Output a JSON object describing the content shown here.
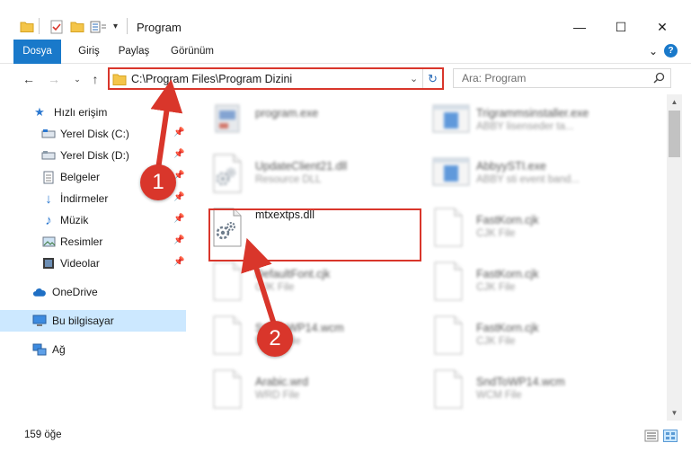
{
  "window": {
    "title": "Program",
    "minimize_glyph": "—",
    "maximize_glyph": "☐",
    "close_glyph": "✕"
  },
  "ribbon": {
    "tabs": [
      "Dosya",
      "Giriş",
      "Paylaş",
      "Görünüm"
    ],
    "expand_glyph": "⌄",
    "help_glyph": "?"
  },
  "address": {
    "path": "C:\\Program Files\\Program Dizini",
    "search_placeholder": "Ara: Program"
  },
  "sidebar": {
    "items": [
      {
        "label": "Hızlı erişim",
        "icon": "star-icon"
      },
      {
        "label": "Yerel Disk (C:)",
        "icon": "drive-icon",
        "pinned": true
      },
      {
        "label": "Yerel Disk (D:)",
        "icon": "drive-icon",
        "pinned": true
      },
      {
        "label": "Belgeler",
        "icon": "document-icon",
        "pinned": true
      },
      {
        "label": "İndirmeler",
        "icon": "download-icon",
        "pinned": true
      },
      {
        "label": "Müzik",
        "icon": "music-icon",
        "pinned": true
      },
      {
        "label": "Resimler",
        "icon": "pictures-icon",
        "pinned": true
      },
      {
        "label": "Videolar",
        "icon": "video-icon",
        "pinned": true
      },
      {
        "label": "OneDrive",
        "icon": "cloud-icon"
      },
      {
        "label": "Bu bilgisayar",
        "icon": "computer-icon",
        "selected": true
      },
      {
        "label": "Ağ",
        "icon": "network-icon"
      }
    ]
  },
  "files": [
    {
      "name": "program.exe",
      "desc": "",
      "col": 0,
      "row": 0,
      "icon": "exe-icon"
    },
    {
      "name": "Trigrammsinstaller.exe",
      "desc": "ABBY lisenseder ta...",
      "col": 1,
      "row": 0,
      "icon": "window-exe-icon"
    },
    {
      "name": "UpdateClient21.dll",
      "desc": "Resource DLL",
      "col": 0,
      "row": 1,
      "icon": "dll-icon"
    },
    {
      "name": "AbbyySTI.exe",
      "desc": "ABBY sti event band...",
      "col": 1,
      "row": 1,
      "icon": "window-exe-icon"
    },
    {
      "name": "mtxextps.dll",
      "desc": "",
      "col": 0,
      "row": 2,
      "icon": "dll-icon",
      "sharp": true
    },
    {
      "name": "FastKorn.cjk",
      "desc": "CJK File",
      "col": 1,
      "row": 2,
      "icon": "blank-file-icon"
    },
    {
      "name": "DefaultFont.cjk",
      "desc": "CJK File",
      "col": 0,
      "row": 3,
      "icon": "blank-file-icon"
    },
    {
      "name": "FastKorn.cjk",
      "desc": "CJK File",
      "col": 1,
      "row": 3,
      "icon": "blank-file-icon"
    },
    {
      "name": "SndToWP14.wcm",
      "desc": "WCM File",
      "col": 0,
      "row": 4,
      "icon": "blank-file-icon"
    },
    {
      "name": "FastKorn.cjk",
      "desc": "CJK File",
      "col": 1,
      "row": 4,
      "icon": "blank-file-icon"
    },
    {
      "name": "Arabic.wrd",
      "desc": "WRD File",
      "col": 0,
      "row": 5,
      "icon": "blank-file-icon"
    },
    {
      "name": "SndToWP14.wcm",
      "desc": "WCM File",
      "col": 1,
      "row": 5,
      "icon": "blank-file-icon"
    }
  ],
  "status": {
    "item_count": "159 öğe"
  },
  "annotations": {
    "step1": "1",
    "step2": "2",
    "accent": "#d9362b"
  },
  "colors": {
    "file_tab": "#1979ca",
    "selected_nav": "#cce8ff",
    "highlight": "#d9362b"
  }
}
